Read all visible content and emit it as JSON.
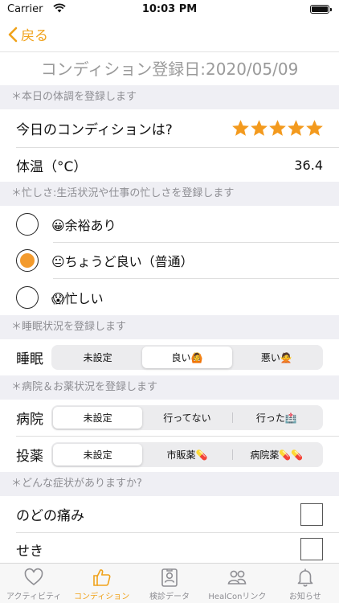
{
  "status_bar": {
    "carrier": "Carrier",
    "time": "10:03 PM"
  },
  "nav": {
    "back_label": "戻る"
  },
  "title": "コンディション登録日:2020/05/09",
  "sections": {
    "health": "＊本日の体調を登録します",
    "busyness": "＊忙しさ:生活状況や仕事の忙しさを登録します",
    "sleep": "＊睡眠状況を登録します",
    "hospital": "＊病院＆お薬状況を登録します",
    "symptoms": "＊どんな症状がありますか?"
  },
  "condition": {
    "label": "今日のコンディションは?",
    "rating": 5,
    "max": 5,
    "star_color": "#f39a1e"
  },
  "temperature": {
    "label": "体温（°C）",
    "value": "36.4"
  },
  "busyness_options": [
    {
      "label": "😀余裕あり",
      "selected": false
    },
    {
      "label": "😐ちょうど良い（普通）",
      "selected": true
    },
    {
      "label": "😱忙しい",
      "selected": false
    }
  ],
  "sleep": {
    "label": "睡眠",
    "options": [
      "未設定",
      "良い🙆",
      "悪い🙅"
    ],
    "selected": 1
  },
  "hospital": {
    "label": "病院",
    "options": [
      "未設定",
      "行ってない",
      "行った🏥"
    ],
    "selected": 0
  },
  "medication": {
    "label": "投薬",
    "options": [
      "未設定",
      "市販薬💊",
      "病院薬💊💊"
    ],
    "selected": 0
  },
  "symptoms": [
    {
      "label": "のどの痛み",
      "checked": false
    },
    {
      "label": "せき",
      "checked": false
    }
  ],
  "tabs": [
    {
      "label": "アクティビティ",
      "icon": "heart-icon",
      "active": false
    },
    {
      "label": "コンディション",
      "icon": "thumbs-up-icon",
      "active": true
    },
    {
      "label": "検診データ",
      "icon": "profile-card-icon",
      "active": false
    },
    {
      "label": "HealConリンク",
      "icon": "people-icon",
      "active": false
    },
    {
      "label": "お知らせ",
      "icon": "bell-icon",
      "active": false
    }
  ],
  "colors": {
    "accent": "#f0a21a",
    "radio_selected": "#f39a2c",
    "section_bg": "#efeff4"
  }
}
